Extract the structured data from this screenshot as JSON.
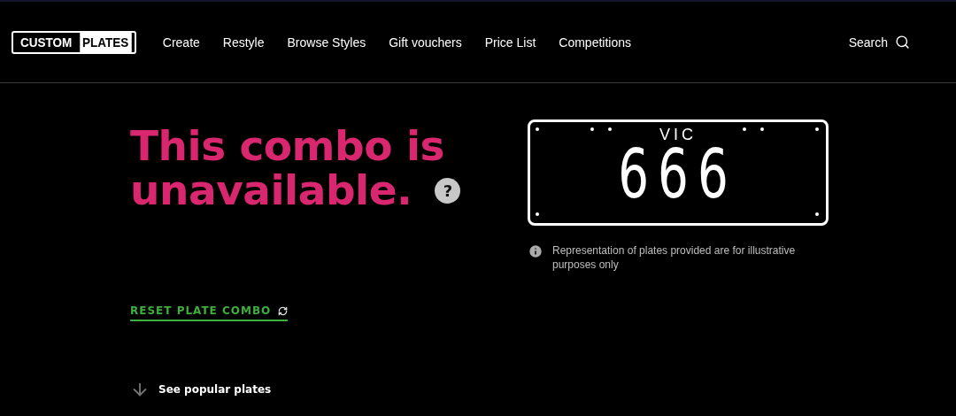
{
  "logo": {
    "left": "CUSTOM",
    "right": "PLATES"
  },
  "nav": [
    {
      "label": "Create"
    },
    {
      "label": "Restyle"
    },
    {
      "label": "Browse Styles"
    },
    {
      "label": "Gift vouchers"
    },
    {
      "label": "Price List"
    },
    {
      "label": "Competitions"
    }
  ],
  "search": {
    "label": "Search"
  },
  "heading": {
    "lines": [
      "This combo is",
      "unavailable."
    ],
    "help": "?"
  },
  "reset": {
    "label": "RESET PLATE COMBO"
  },
  "popular": {
    "label": "See popular plates"
  },
  "plate": {
    "state": "VIC",
    "number": "666"
  },
  "note": {
    "text": "Representation of plates provided are for illustrative purposes only"
  }
}
